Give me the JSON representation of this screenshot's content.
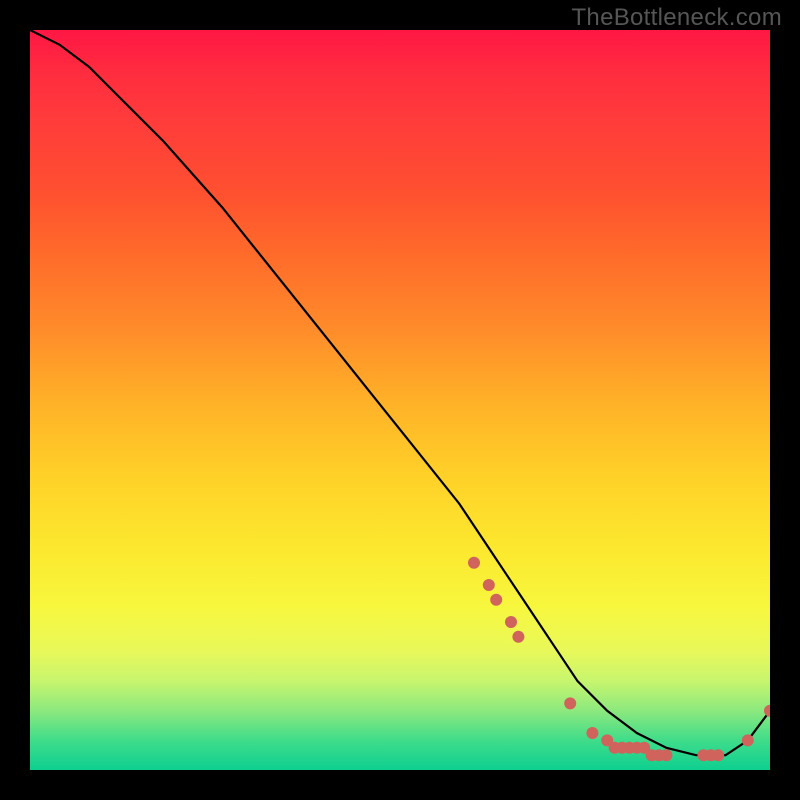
{
  "watermark": "TheBottleneck.com",
  "colors": {
    "point": "#d0635c",
    "curve": "#000000"
  },
  "chart_data": {
    "type": "line",
    "title": "",
    "xlabel": "",
    "ylabel": "",
    "xlim": [
      0,
      100
    ],
    "ylim": [
      0,
      100
    ],
    "grid": false,
    "legend": false,
    "series": [
      {
        "name": "curve",
        "x": [
          0,
          4,
          8,
          12,
          18,
          26,
          34,
          42,
          50,
          58,
          62,
          66,
          70,
          74,
          78,
          82,
          86,
          90,
          94,
          97,
          100
        ],
        "y": [
          100,
          98,
          95,
          91,
          85,
          76,
          66,
          56,
          46,
          36,
          30,
          24,
          18,
          12,
          8,
          5,
          3,
          2,
          2,
          4,
          8
        ]
      }
    ],
    "points": [
      {
        "x": 60,
        "y": 28
      },
      {
        "x": 62,
        "y": 25
      },
      {
        "x": 63,
        "y": 23
      },
      {
        "x": 65,
        "y": 20
      },
      {
        "x": 66,
        "y": 18
      },
      {
        "x": 73,
        "y": 9
      },
      {
        "x": 76,
        "y": 5
      },
      {
        "x": 78,
        "y": 4
      },
      {
        "x": 79,
        "y": 3
      },
      {
        "x": 80,
        "y": 3
      },
      {
        "x": 81,
        "y": 3
      },
      {
        "x": 82,
        "y": 3
      },
      {
        "x": 83,
        "y": 3
      },
      {
        "x": 84,
        "y": 2
      },
      {
        "x": 85,
        "y": 2
      },
      {
        "x": 86,
        "y": 2
      },
      {
        "x": 91,
        "y": 2
      },
      {
        "x": 92,
        "y": 2
      },
      {
        "x": 93,
        "y": 2
      },
      {
        "x": 97,
        "y": 4
      },
      {
        "x": 100,
        "y": 8
      }
    ]
  }
}
